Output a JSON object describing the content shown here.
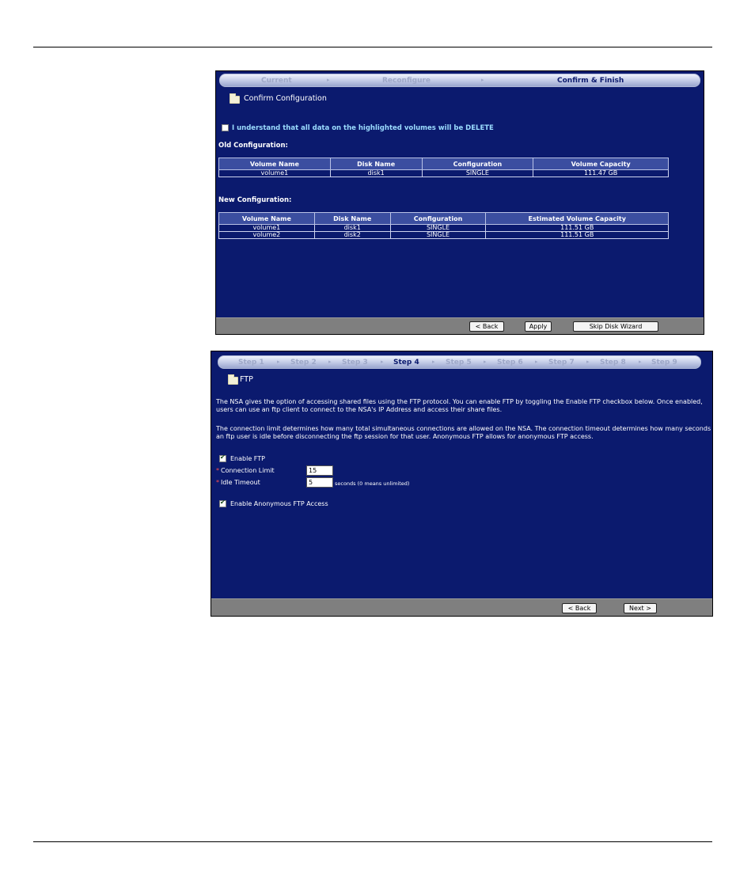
{
  "panel1": {
    "steps": [
      "Current",
      "Reconfigure",
      "Confirm & Finish"
    ],
    "active_step": 2,
    "title": "Confirm Configuration",
    "confirm_checkbox_label": "I understand that all data on the highlighted volumes will be DELETE",
    "old_label": "Old Configuration:",
    "old_headers": [
      "Volume Name",
      "Disk Name",
      "Configuration",
      "Volume Capacity"
    ],
    "old_rows": [
      [
        "volume1",
        "disk1",
        "SINGLE",
        "111.47 GB"
      ]
    ],
    "new_label": "New Configuration:",
    "new_headers": [
      "Volume Name",
      "Disk Name",
      "Configuration",
      "Estimated Volume Capacity"
    ],
    "new_rows": [
      [
        "volume1",
        "disk1",
        "SINGLE",
        "111.51 GB"
      ],
      [
        "volume2",
        "disk2",
        "SINGLE",
        "111.51 GB"
      ]
    ],
    "back_label": "< Back",
    "apply_label": "Apply",
    "skip_label": "Skip Disk Wizard"
  },
  "panel2": {
    "steps": [
      "Step 1",
      "Step 2",
      "Step 3",
      "Step 4",
      "Step 5",
      "Step 6",
      "Step 7",
      "Step 8",
      "Step 9"
    ],
    "active_step": 3,
    "title": "FTP",
    "para1": "The NSA gives the option of accessing shared files using the FTP protocol. You can enable FTP by toggling the Enable FTP checkbox below. Once enabled, users can use an ftp client to connect to the NSA's IP Address and access their share files.",
    "para2": "The connection limit determines how many total simultaneous connections are allowed on the NSA. The connection timeout determines how many seconds an ftp user is idle before disconnecting the ftp session for that user. Anonymous FTP allows for anonymous FTP access.",
    "enable_ftp_label": "Enable FTP",
    "enable_ftp_checked": true,
    "required_mark": "*",
    "connection_limit_label": "Connection Limit",
    "connection_limit_value": "15",
    "idle_timeout_label": "Idle Timeout",
    "idle_timeout_value": "5",
    "idle_timeout_hint": "seconds (0 means unlimited)",
    "anonymous_label": "Enable Anonymous FTP Access",
    "anonymous_checked": true,
    "back_label": "< Back",
    "next_label": "Next >"
  }
}
